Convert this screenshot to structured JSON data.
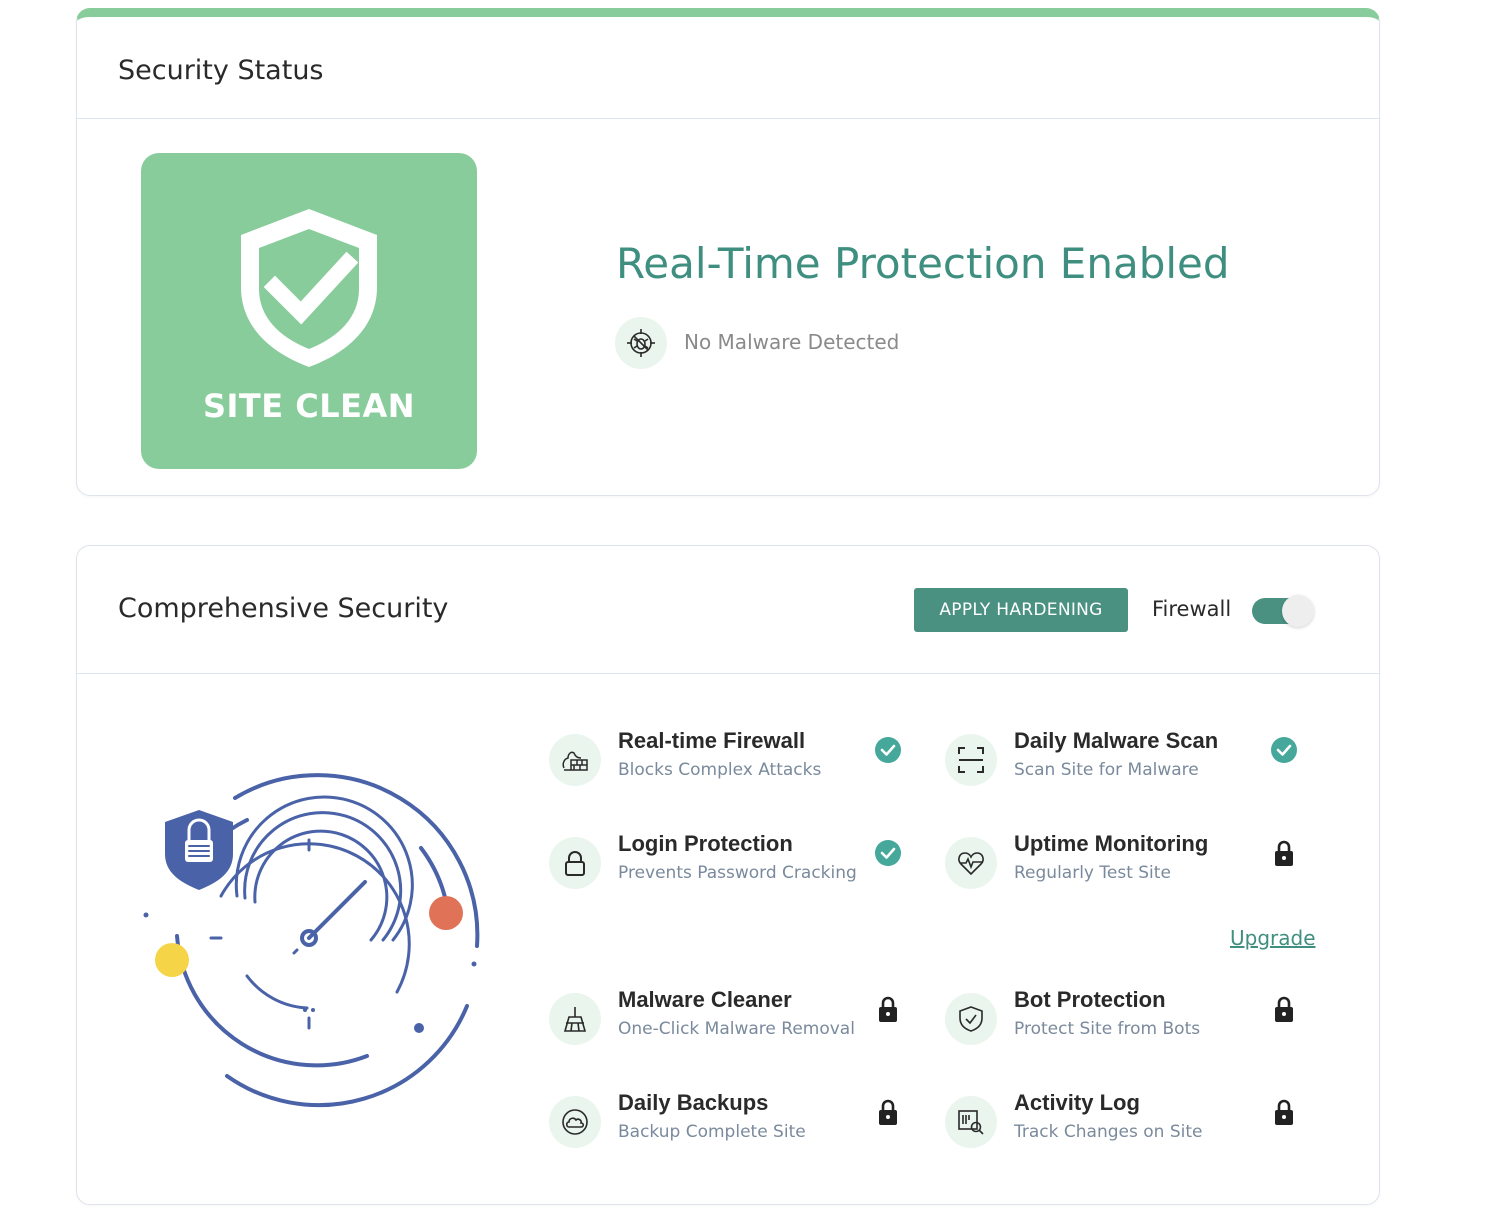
{
  "status_card": {
    "title": "Security Status",
    "badge_label": "SITE CLEAN",
    "protection_title": "Real-Time Protection Enabled",
    "malware_status": "No Malware Detected"
  },
  "security_card": {
    "title": "Comprehensive Security",
    "apply_button": "APPLY HARDENING",
    "firewall_label": "Firewall",
    "firewall_enabled": true,
    "upgrade_link": "Upgrade",
    "features": [
      {
        "title": "Real-time Firewall",
        "subtitle": "Blocks Complex Attacks",
        "status": "enabled",
        "icon": "firewall-icon"
      },
      {
        "title": "Daily Malware Scan",
        "subtitle": "Scan Site for Malware",
        "status": "enabled",
        "icon": "scan-icon"
      },
      {
        "title": "Login Protection",
        "subtitle": "Prevents Password Cracking",
        "status": "enabled",
        "icon": "padlock-icon"
      },
      {
        "title": "Uptime Monitoring",
        "subtitle": "Regularly Test Site",
        "status": "locked",
        "icon": "heartbeat-icon"
      },
      {
        "title": "Malware Cleaner",
        "subtitle": "One-Click Malware Removal",
        "status": "locked",
        "icon": "broom-icon"
      },
      {
        "title": "Bot Protection",
        "subtitle": "Protect Site from Bots",
        "status": "locked",
        "icon": "shield-check-icon"
      },
      {
        "title": "Daily Backups",
        "subtitle": "Backup Complete Site",
        "status": "locked",
        "icon": "cloud-sync-icon"
      },
      {
        "title": "Activity Log",
        "subtitle": "Track Changes on Site",
        "status": "locked",
        "icon": "log-search-icon"
      }
    ]
  },
  "colors": {
    "accent_green": "#88cc9b",
    "teal": "#4a9182",
    "title_teal": "#3f8f80",
    "check_teal": "#45a89a",
    "illustration_blue": "#4a63a8"
  }
}
